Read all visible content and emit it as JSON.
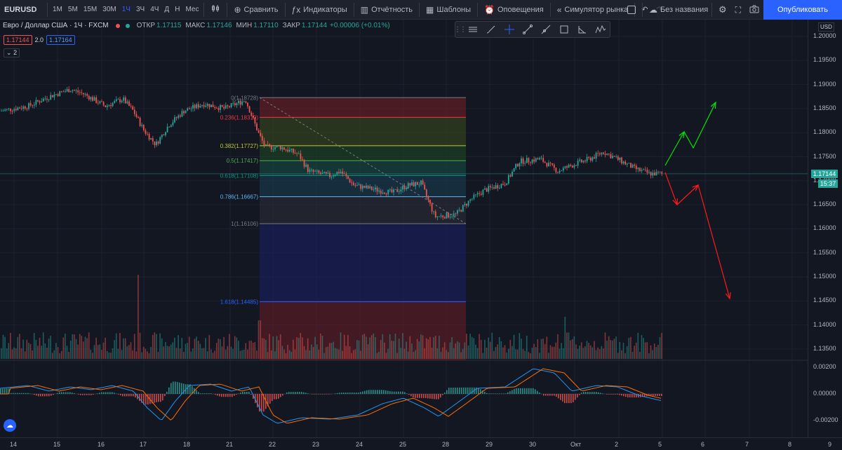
{
  "toolbar": {
    "symbol": "EURUSD",
    "timeframes": [
      "1М",
      "5М",
      "15М",
      "30М",
      "1Ч",
      "3Ч",
      "4Ч",
      "Д",
      "Н",
      "Мес"
    ],
    "active_timeframe": "1Ч",
    "compare_label": "Сравнить",
    "indicators_label": "Индикаторы",
    "financials_label": "Отчётность",
    "templates_label": "Шаблоны",
    "alerts_label": "Оповещения",
    "replay_label": "Симулятор рынка",
    "layout_label": "Без названия",
    "publish_label": "Опубликовать"
  },
  "legend": {
    "title": "Евро / Доллар США · 1Ч · FXCM",
    "open_label": "ОТКР",
    "open": "1.17115",
    "high_label": "МАКС",
    "high": "1.17146",
    "low_label": "МИН",
    "low": "1.17110",
    "close_label": "ЗАКР",
    "close": "1.17144",
    "change": "+0.00006 (+0.01%)",
    "bid": "1.17144",
    "spread": "2.0",
    "ask": "1.17164",
    "collapse": "2"
  },
  "price_axis": {
    "currency": "USD",
    "labels": [
      "1.20000",
      "1.19500",
      "1.19000",
      "1.18500",
      "1.18000",
      "1.17500",
      "1.17000",
      "1.16500",
      "1.16000",
      "1.15500",
      "1.15000",
      "1.14500",
      "1.14000",
      "1.13500"
    ],
    "current_price": "1.17144",
    "countdown": "15:37",
    "macd_labels": [
      "0.00200",
      "0.00000",
      "-0.00200"
    ]
  },
  "time_axis": {
    "labels": [
      "14",
      "15",
      "16",
      "17",
      "18",
      "21",
      "22",
      "23",
      "24",
      "25",
      "28",
      "29",
      "30",
      "Окт",
      "2",
      "5",
      "6",
      "7",
      "8",
      "9"
    ]
  },
  "fib_levels": [
    {
      "ratio": 0,
      "label": "0(1.18728)",
      "price": 1.18728,
      "color": "#787b86"
    },
    {
      "ratio": 0.236,
      "label": "0.236(1.18319)",
      "price": 1.18319,
      "color": "#f23645"
    },
    {
      "ratio": 0.382,
      "label": "0.382(1.17727)",
      "price": 1.17727,
      "color": "#c0ca33"
    },
    {
      "ratio": 0.5,
      "label": "0.5(1.17417)",
      "price": 1.17417,
      "color": "#4caf50"
    },
    {
      "ratio": 0.618,
      "label": "0.618(1.17108)",
      "price": 1.17108,
      "color": "#089981"
    },
    {
      "ratio": 0.786,
      "label": "0.786(1.16667)",
      "price": 1.16667,
      "color": "#64b5f6"
    },
    {
      "ratio": 1,
      "label": "1(1.16106)",
      "price": 1.16106,
      "color": "#787b86"
    },
    {
      "ratio": 1.618,
      "label": "1.618(1.14485)",
      "price": 1.14485,
      "color": "#2962ff"
    }
  ],
  "colors": {
    "up": "#26a69a",
    "down": "#ef5350",
    "macd": "#2196f3",
    "signal": "#ff6d00",
    "arrow_up": "#00e600",
    "arrow_down": "#ff1a1a",
    "accent": "#2962ff"
  }
}
